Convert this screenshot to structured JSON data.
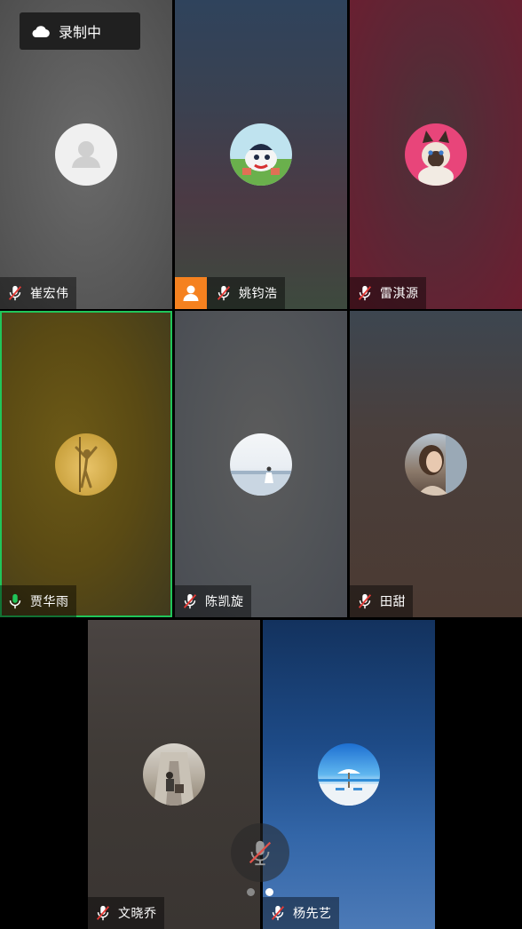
{
  "recording": {
    "label": "录制中",
    "icon": "cloud-icon"
  },
  "participants": [
    {
      "name": "崔宏伟",
      "status": "muted",
      "avatar": "default-avatar"
    },
    {
      "name": "姚钧浩",
      "status": "muted",
      "role": "host",
      "avatar": "cartoon-cat-avatar"
    },
    {
      "name": "雷淇源",
      "status": "muted",
      "avatar": "siamese-cat-avatar"
    },
    {
      "name": "贾华雨",
      "status": "speaking",
      "active": true,
      "avatar": "dancer-silhouette-avatar"
    },
    {
      "name": "陈凯旋",
      "status": "muted",
      "avatar": "beach-person-avatar"
    },
    {
      "name": "田甜",
      "status": "muted",
      "avatar": "girl-portrait-avatar"
    },
    {
      "name": "文晓乔",
      "status": "muted",
      "avatar": "hallway-person-avatar"
    },
    {
      "name": "杨先艺",
      "status": "muted",
      "avatar": "beach-umbrella-avatar"
    }
  ],
  "controls": {
    "mute_icon": "mic-off-icon"
  },
  "pager": {
    "pages": 2,
    "current": 2
  },
  "colors": {
    "active_border": "#20c55a",
    "host_badge": "#f5811f",
    "speaking_mic": "#20c55a"
  }
}
